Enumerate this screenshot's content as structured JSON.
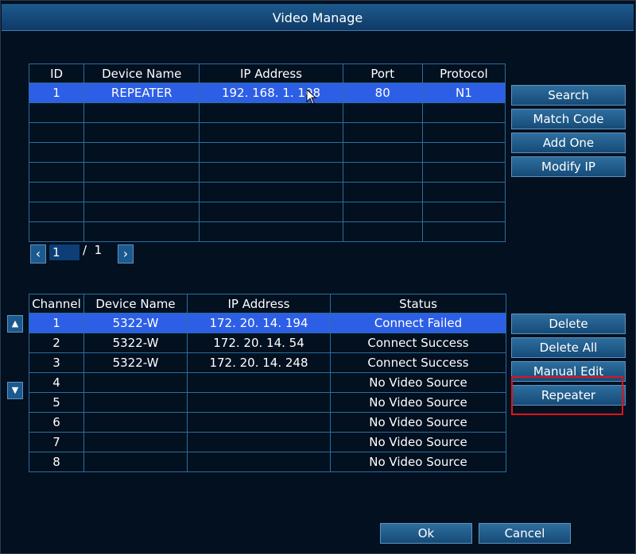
{
  "window": {
    "title": "Video Manage"
  },
  "search_table": {
    "headers": [
      "ID",
      "Device Name",
      "IP Address",
      "Port",
      "Protocol"
    ],
    "rows": [
      [
        "1",
        "REPEATER",
        "192. 168. 1. 108",
        "80",
        "N1"
      ],
      [
        "",
        "",
        "",
        "",
        ""
      ],
      [
        "",
        "",
        "",
        "",
        ""
      ],
      [
        "",
        "",
        "",
        "",
        ""
      ],
      [
        "",
        "",
        "",
        "",
        ""
      ],
      [
        "",
        "",
        "",
        "",
        ""
      ],
      [
        "",
        "",
        "",
        "",
        ""
      ],
      [
        "",
        "",
        "",
        "",
        ""
      ]
    ],
    "selected_row": 0
  },
  "pager": {
    "prev_icon": "chevron-left-icon",
    "next_icon": "chevron-right-icon",
    "current": "1",
    "separator": "/",
    "total": "1"
  },
  "search_buttons": [
    "Search",
    "Match Code",
    "Add One",
    "Modify IP"
  ],
  "channel_table": {
    "headers": [
      "Channel",
      "Device Name",
      "IP Address",
      "Status"
    ],
    "rows": [
      [
        "1",
        "5322-W",
        "172. 20. 14. 194",
        "Connect Failed"
      ],
      [
        "2",
        "5322-W",
        "172. 20. 14. 54",
        "Connect Success"
      ],
      [
        "3",
        "5322-W",
        "172. 20. 14. 248",
        "Connect Success"
      ],
      [
        "4",
        "",
        "",
        "No Video Source"
      ],
      [
        "5",
        "",
        "",
        "No Video Source"
      ],
      [
        "6",
        "",
        "",
        "No Video Source"
      ],
      [
        "7",
        "",
        "",
        "No Video Source"
      ],
      [
        "8",
        "",
        "",
        "No Video Source"
      ]
    ],
    "selected_row": 0
  },
  "move_buttons": {
    "up_icon": "triangle-up-icon",
    "up_glyph": "▲",
    "down_icon": "triangle-down-icon",
    "down_glyph": "▼"
  },
  "channel_buttons": [
    "Delete",
    "Delete All",
    "Manual Edit",
    "Repeater"
  ],
  "footer": {
    "ok": "Ok",
    "cancel": "Cancel"
  },
  "colors": {
    "selected_row": "#2d5fe6",
    "highlight_box": "#e0141c",
    "title_bar": "#1d5a8e"
  }
}
